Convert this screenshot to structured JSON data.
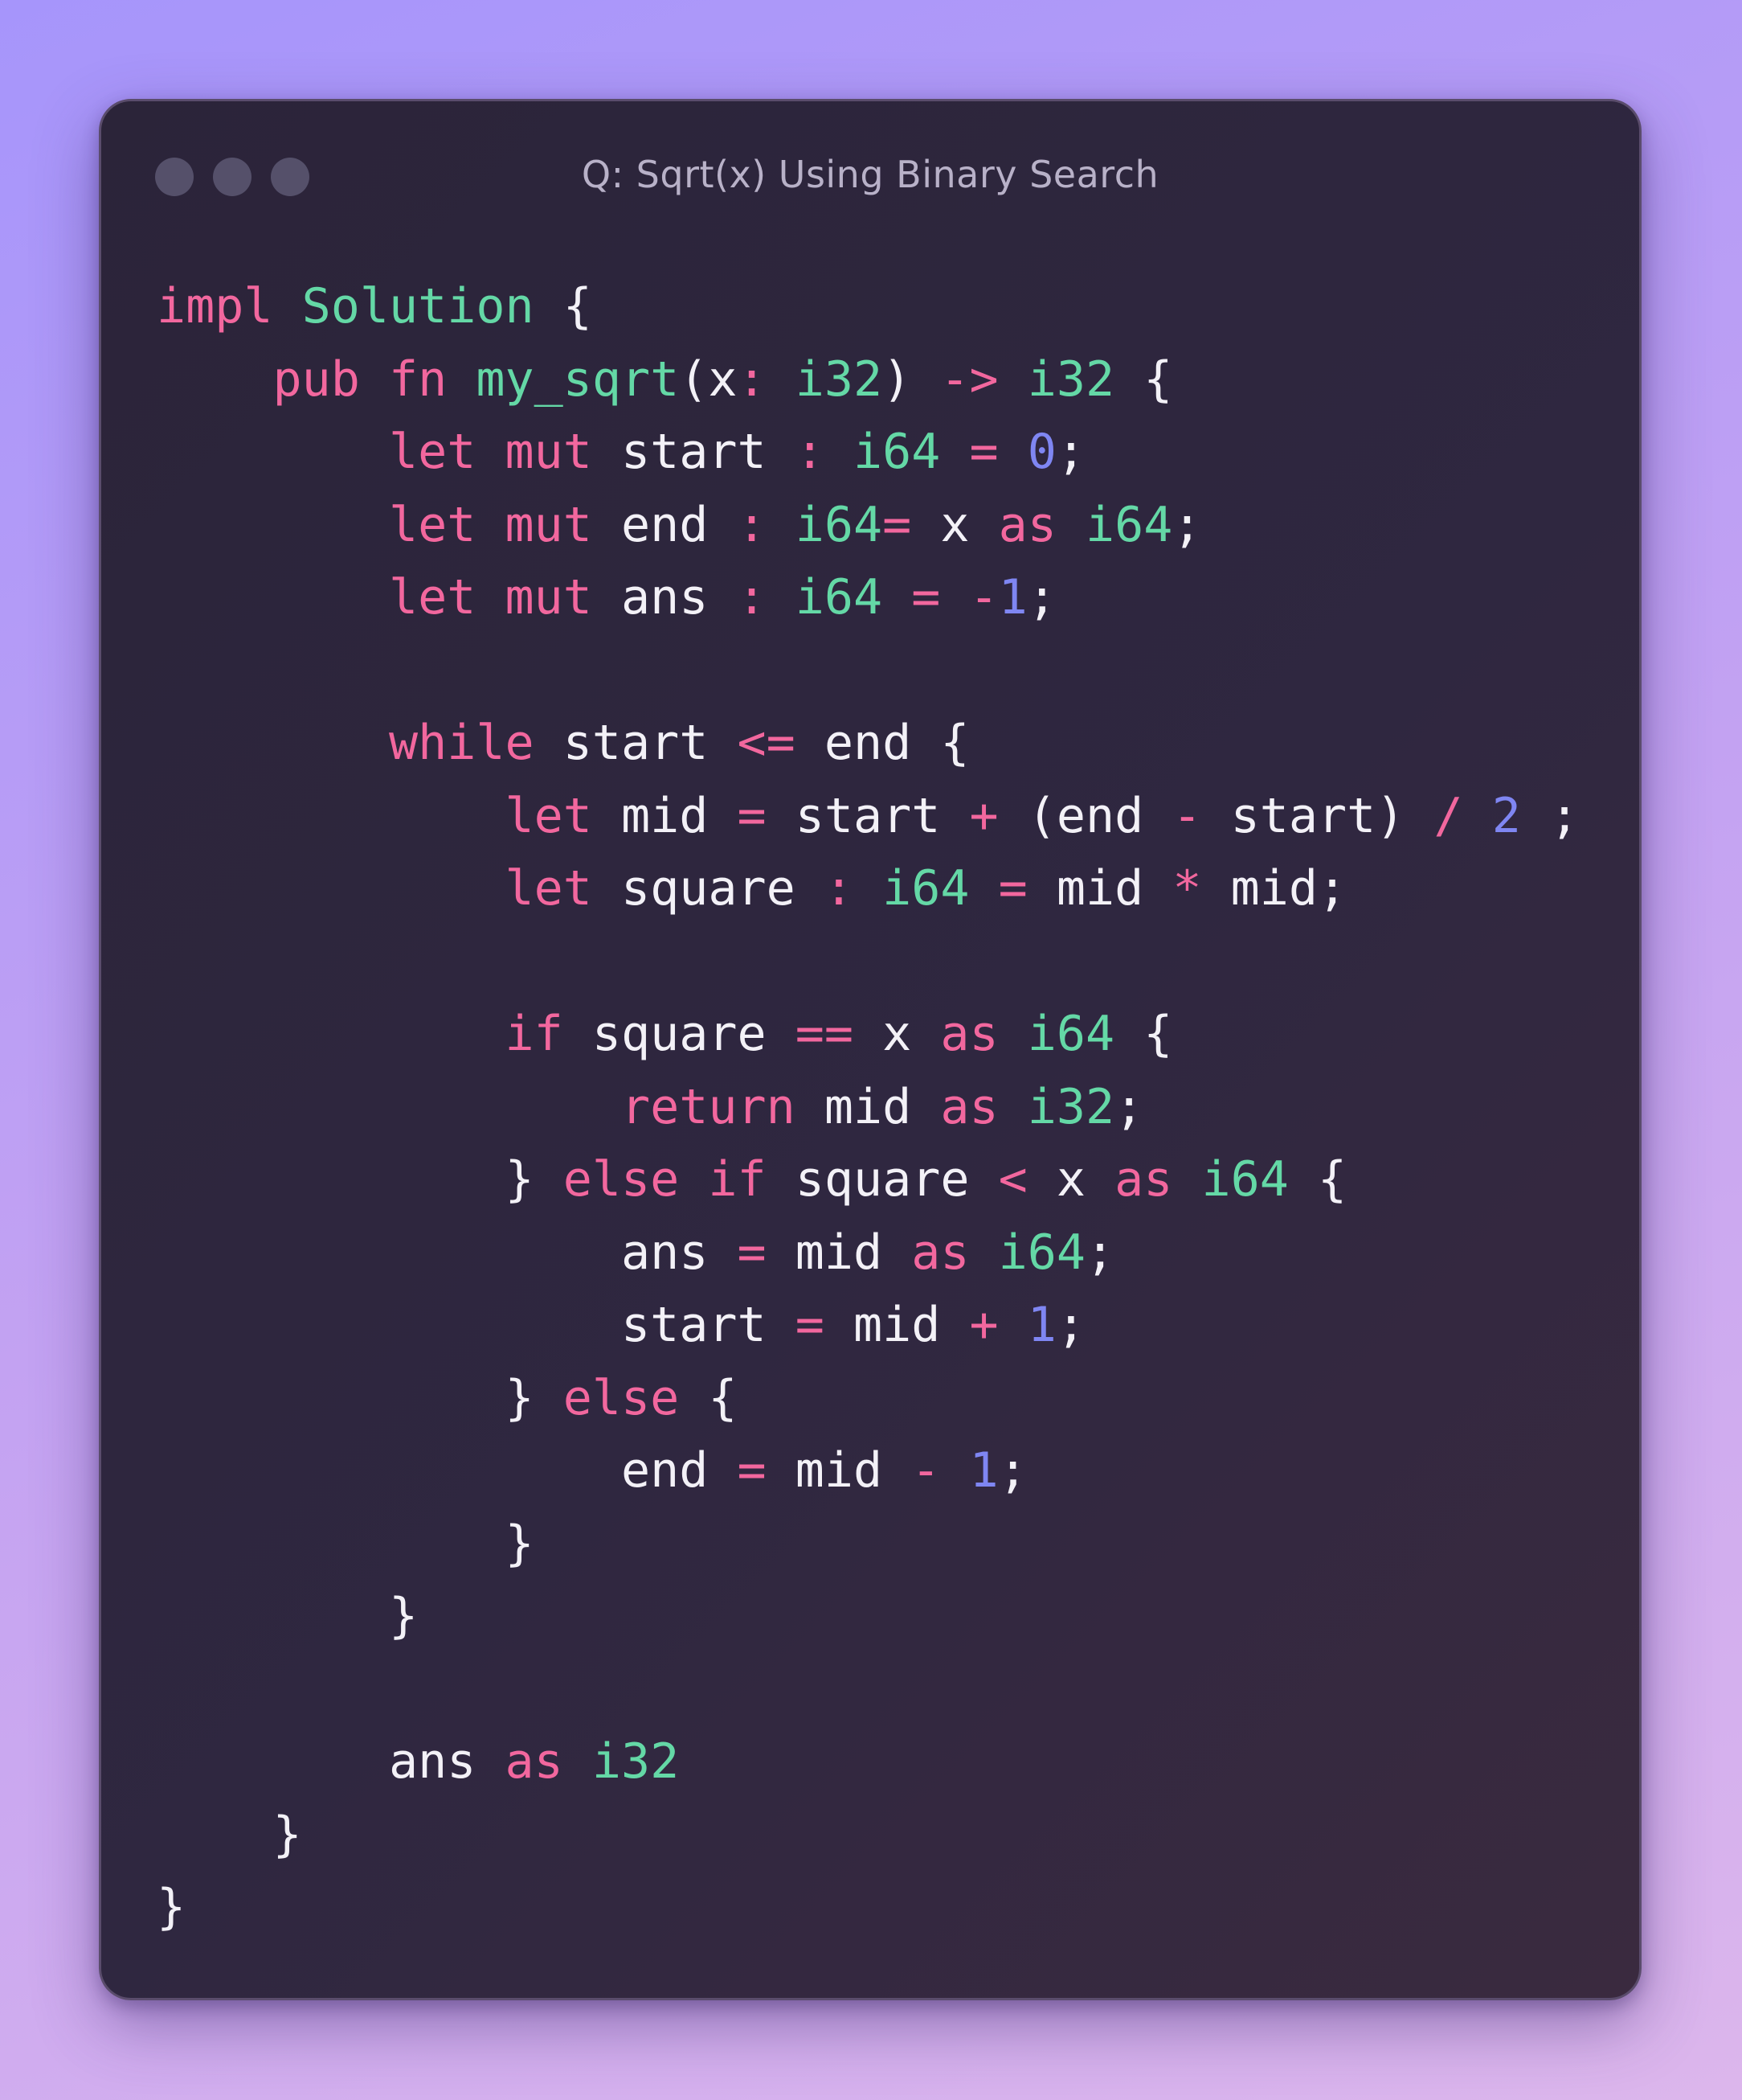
{
  "window": {
    "title": "Q: Sqrt(x) Using Binary Search",
    "controls": [
      "close-dot",
      "minimize-dot",
      "zoom-dot"
    ]
  },
  "theme": {
    "keyword": "#f2679e",
    "type": "#64d8a6",
    "number": "#7f86f2",
    "text": "#f3f1f7",
    "background": "#2d2639"
  },
  "code": {
    "language": "rust",
    "lines": [
      [
        [
          "kw",
          "impl"
        ],
        [
          "pl",
          " "
        ],
        [
          "ty",
          "Solution"
        ],
        [
          "pl",
          " {"
        ]
      ],
      [
        [
          "pl",
          "    "
        ],
        [
          "kw",
          "pub"
        ],
        [
          "pl",
          " "
        ],
        [
          "kw",
          "fn"
        ],
        [
          "pl",
          " "
        ],
        [
          "ty",
          "my_sqrt"
        ],
        [
          "pl",
          "(x"
        ],
        [
          "op",
          ":"
        ],
        [
          "pl",
          " "
        ],
        [
          "ty",
          "i32"
        ],
        [
          "pl",
          ") "
        ],
        [
          "op",
          "->"
        ],
        [
          "pl",
          " "
        ],
        [
          "ty",
          "i32"
        ],
        [
          "pl",
          " {"
        ]
      ],
      [
        [
          "pl",
          "        "
        ],
        [
          "kw",
          "let"
        ],
        [
          "pl",
          " "
        ],
        [
          "kw",
          "mut"
        ],
        [
          "pl",
          " start "
        ],
        [
          "op",
          ":"
        ],
        [
          "pl",
          " "
        ],
        [
          "ty",
          "i64"
        ],
        [
          "pl",
          " "
        ],
        [
          "op",
          "="
        ],
        [
          "pl",
          " "
        ],
        [
          "nm",
          "0"
        ],
        [
          "pl",
          ";"
        ]
      ],
      [
        [
          "pl",
          "        "
        ],
        [
          "kw",
          "let"
        ],
        [
          "pl",
          " "
        ],
        [
          "kw",
          "mut"
        ],
        [
          "pl",
          " end "
        ],
        [
          "op",
          ":"
        ],
        [
          "pl",
          " "
        ],
        [
          "ty",
          "i64"
        ],
        [
          "op",
          "="
        ],
        [
          "pl",
          " x "
        ],
        [
          "kw",
          "as"
        ],
        [
          "pl",
          " "
        ],
        [
          "ty",
          "i64"
        ],
        [
          "pl",
          ";"
        ]
      ],
      [
        [
          "pl",
          "        "
        ],
        [
          "kw",
          "let"
        ],
        [
          "pl",
          " "
        ],
        [
          "kw",
          "mut"
        ],
        [
          "pl",
          " ans "
        ],
        [
          "op",
          ":"
        ],
        [
          "pl",
          " "
        ],
        [
          "ty",
          "i64"
        ],
        [
          "pl",
          " "
        ],
        [
          "op",
          "="
        ],
        [
          "pl",
          " "
        ],
        [
          "op",
          "-"
        ],
        [
          "nm",
          "1"
        ],
        [
          "pl",
          ";"
        ]
      ],
      [],
      [
        [
          "pl",
          "        "
        ],
        [
          "kw",
          "while"
        ],
        [
          "pl",
          " start "
        ],
        [
          "op",
          "<="
        ],
        [
          "pl",
          " end {"
        ]
      ],
      [
        [
          "pl",
          "            "
        ],
        [
          "kw",
          "let"
        ],
        [
          "pl",
          " mid "
        ],
        [
          "op",
          "="
        ],
        [
          "pl",
          " start "
        ],
        [
          "op",
          "+"
        ],
        [
          "pl",
          " (end "
        ],
        [
          "op",
          "-"
        ],
        [
          "pl",
          " start) "
        ],
        [
          "op",
          "/"
        ],
        [
          "pl",
          " "
        ],
        [
          "nm",
          "2"
        ],
        [
          "pl",
          " ;"
        ]
      ],
      [
        [
          "pl",
          "            "
        ],
        [
          "kw",
          "let"
        ],
        [
          "pl",
          " square "
        ],
        [
          "op",
          ":"
        ],
        [
          "pl",
          " "
        ],
        [
          "ty",
          "i64"
        ],
        [
          "pl",
          " "
        ],
        [
          "op",
          "="
        ],
        [
          "pl",
          " mid "
        ],
        [
          "op",
          "*"
        ],
        [
          "pl",
          " mid;"
        ]
      ],
      [],
      [
        [
          "pl",
          "            "
        ],
        [
          "kw",
          "if"
        ],
        [
          "pl",
          " square "
        ],
        [
          "op",
          "=="
        ],
        [
          "pl",
          " x "
        ],
        [
          "kw",
          "as"
        ],
        [
          "pl",
          " "
        ],
        [
          "ty",
          "i64"
        ],
        [
          "pl",
          " {"
        ]
      ],
      [
        [
          "pl",
          "                "
        ],
        [
          "kw",
          "return"
        ],
        [
          "pl",
          " mid "
        ],
        [
          "kw",
          "as"
        ],
        [
          "pl",
          " "
        ],
        [
          "ty",
          "i32"
        ],
        [
          "pl",
          ";"
        ]
      ],
      [
        [
          "pl",
          "            } "
        ],
        [
          "kw",
          "else"
        ],
        [
          "pl",
          " "
        ],
        [
          "kw",
          "if"
        ],
        [
          "pl",
          " square "
        ],
        [
          "op",
          "<"
        ],
        [
          "pl",
          " x "
        ],
        [
          "kw",
          "as"
        ],
        [
          "pl",
          " "
        ],
        [
          "ty",
          "i64"
        ],
        [
          "pl",
          " {"
        ]
      ],
      [
        [
          "pl",
          "                ans "
        ],
        [
          "op",
          "="
        ],
        [
          "pl",
          " mid "
        ],
        [
          "kw",
          "as"
        ],
        [
          "pl",
          " "
        ],
        [
          "ty",
          "i64"
        ],
        [
          "pl",
          ";"
        ]
      ],
      [
        [
          "pl",
          "                start "
        ],
        [
          "op",
          "="
        ],
        [
          "pl",
          " mid "
        ],
        [
          "op",
          "+"
        ],
        [
          "pl",
          " "
        ],
        [
          "nm",
          "1"
        ],
        [
          "pl",
          ";"
        ]
      ],
      [
        [
          "pl",
          "            } "
        ],
        [
          "kw",
          "else"
        ],
        [
          "pl",
          " {"
        ]
      ],
      [
        [
          "pl",
          "                end "
        ],
        [
          "op",
          "="
        ],
        [
          "pl",
          " mid "
        ],
        [
          "op",
          "-"
        ],
        [
          "pl",
          " "
        ],
        [
          "nm",
          "1"
        ],
        [
          "pl",
          ";"
        ]
      ],
      [
        [
          "pl",
          "            }"
        ]
      ],
      [
        [
          "pl",
          "        }"
        ]
      ],
      [],
      [
        [
          "pl",
          "        ans "
        ],
        [
          "kw",
          "as"
        ],
        [
          "pl",
          " "
        ],
        [
          "ty",
          "i32"
        ]
      ],
      [
        [
          "pl",
          "    }"
        ]
      ],
      [
        [
          "pl",
          "}"
        ]
      ]
    ]
  }
}
